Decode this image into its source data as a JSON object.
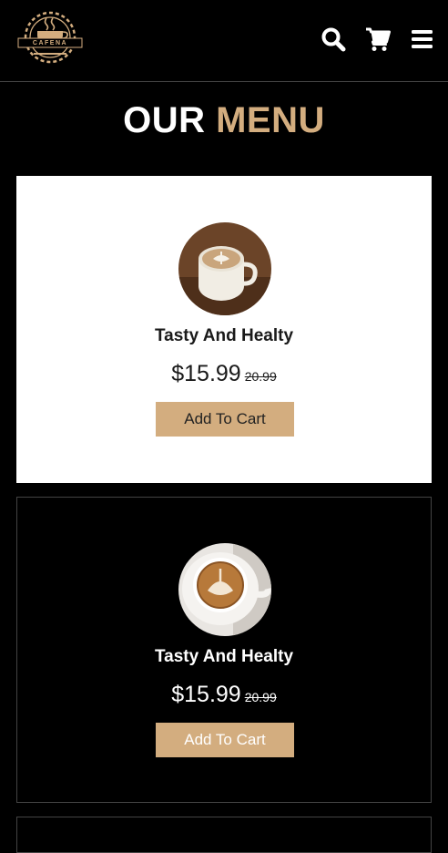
{
  "brand": {
    "logo_text": "CAFENA"
  },
  "header": {
    "icons": [
      "search-icon",
      "cart-icon",
      "menu-bars-icon"
    ]
  },
  "section": {
    "title_word1": "OUR",
    "title_word2": "MENU"
  },
  "colors": {
    "accent": "#d3ad7f",
    "background": "#000000",
    "card_light": "#ffffff"
  },
  "menu_items": [
    {
      "name": "Tasty And Healty",
      "price": "$15.99",
      "old_price": "20.99",
      "button_label": "Add To Cart"
    },
    {
      "name": "Tasty And Healty",
      "price": "$15.99",
      "old_price": "20.99",
      "button_label": "Add To Cart"
    }
  ]
}
